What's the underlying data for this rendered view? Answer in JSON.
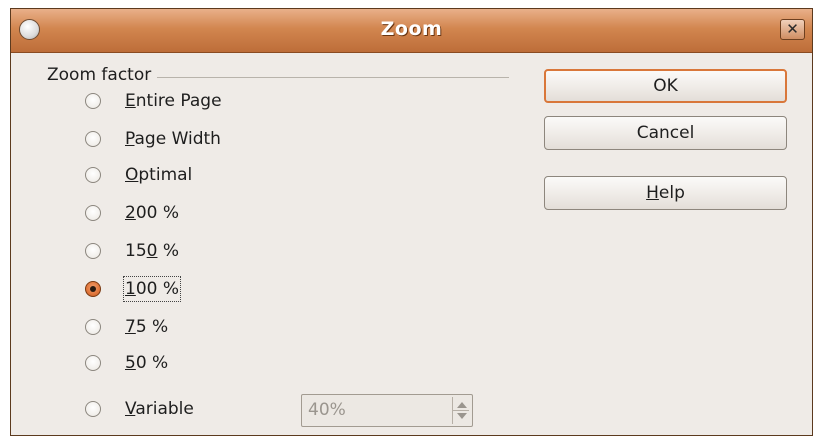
{
  "window": {
    "title": "Zoom",
    "close_glyph": "✕",
    "title_icon": "app-icon"
  },
  "group": {
    "label": "Zoom factor"
  },
  "options": [
    {
      "mnemonic": "E",
      "rest": "ntire Page",
      "checked": false
    },
    {
      "mnemonic": "P",
      "rest": "age Width",
      "checked": false
    },
    {
      "mnemonic": "O",
      "rest": "ptimal",
      "checked": false
    },
    {
      "mnemonic": "2",
      "rest": "00 %",
      "checked": false
    },
    {
      "pre": "15",
      "mnemonic": "0",
      "rest": " %",
      "checked": false
    },
    {
      "mnemonic": "1",
      "rest": "00 %",
      "checked": true
    },
    {
      "mnemonic": "7",
      "rest": "5 %",
      "checked": false
    },
    {
      "mnemonic": "5",
      "rest": "0 %",
      "checked": false
    },
    {
      "mnemonic": "V",
      "rest": "ariable",
      "checked": false
    }
  ],
  "variable": {
    "value": "40%"
  },
  "buttons": {
    "ok": "OK",
    "cancel": "Cancel",
    "help_mnemonic": "H",
    "help_rest": "elp"
  },
  "colors": {
    "titlebar": "#d2864f",
    "accent": "#e0753a",
    "dialog_bg": "#efebe7"
  }
}
